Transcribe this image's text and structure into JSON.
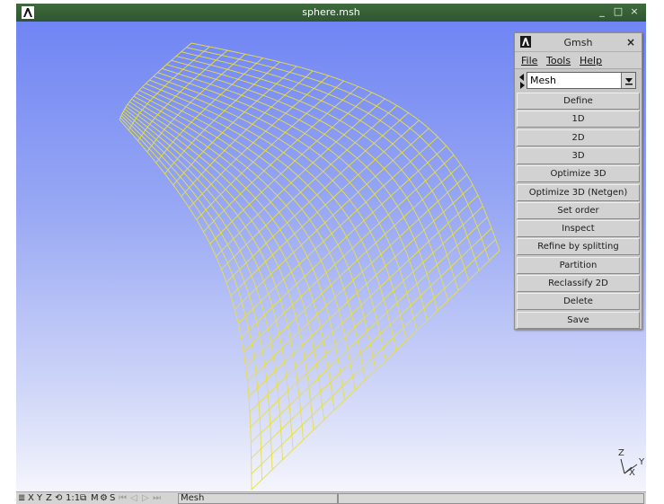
{
  "window": {
    "title": "sphere.msh",
    "controls": {
      "minimize": "_",
      "maximize": "□",
      "close": "×"
    }
  },
  "statusbar": {
    "icons": [
      "≣",
      "X",
      "Y",
      "Z",
      "⟲",
      "1:1",
      "⧉",
      "M",
      "⚙",
      "S",
      "⏮",
      "◁",
      "▷",
      "⏭"
    ],
    "message": "Mesh"
  },
  "axes": {
    "z": "Z",
    "y": "Y",
    "x": "X"
  },
  "panel": {
    "title": "Gmsh",
    "close": "×",
    "menu": {
      "file": "File",
      "tools": "Tools",
      "help": "Help"
    },
    "module": "Mesh",
    "buttons": [
      "Define",
      "1D",
      "2D",
      "3D",
      "Optimize 3D",
      "Optimize 3D (Netgen)",
      "Set order",
      "Inspect",
      "Refine by splitting",
      "Partition",
      "Reclassify 2D",
      "Delete",
      "Save"
    ]
  },
  "colors": {
    "mesh": "#e8e040",
    "titlebar": "#2e5530",
    "background_top": "#7085f4",
    "background_bottom": "#f4f5fc"
  }
}
